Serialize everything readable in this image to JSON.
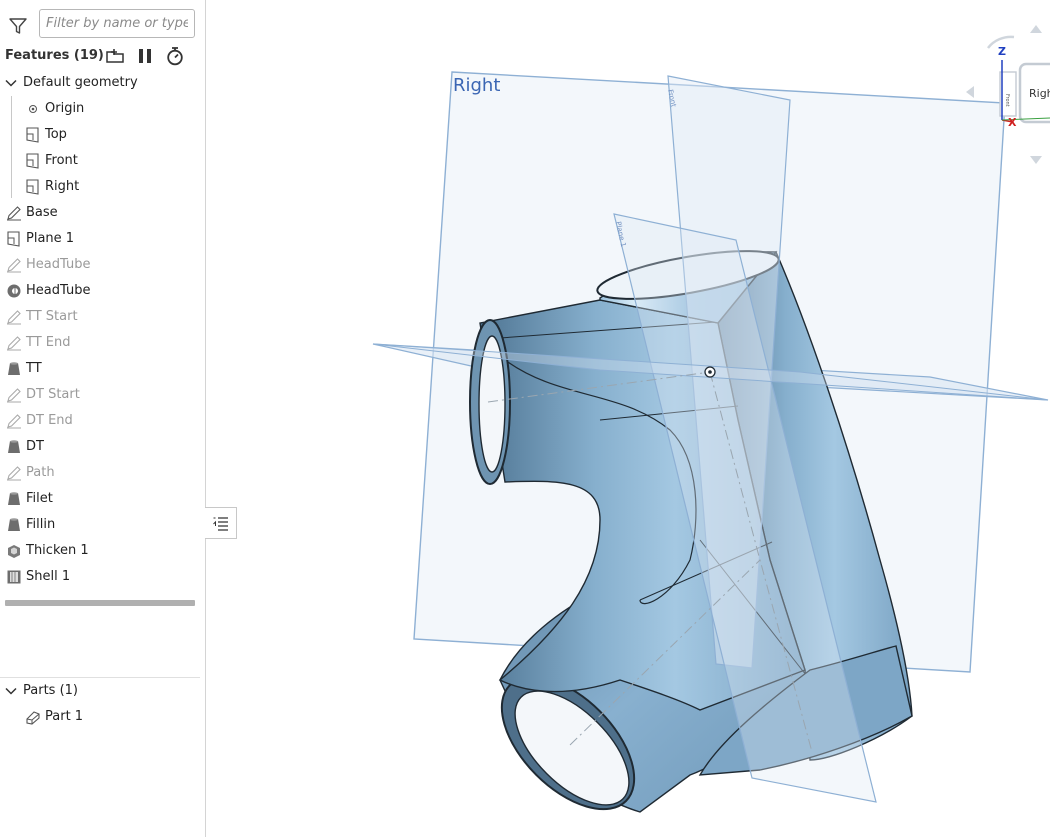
{
  "filter": {
    "placeholder": "Filter by name or type"
  },
  "features": {
    "title": "Features (19)",
    "items": [
      {
        "label": "Default geometry",
        "icon": "chevron-down-icon",
        "suppressed": false
      },
      {
        "label": "Origin",
        "icon": "origin-icon",
        "suppressed": false
      },
      {
        "label": "Top",
        "icon": "plane-icon",
        "suppressed": false
      },
      {
        "label": "Front",
        "icon": "plane-icon",
        "suppressed": false
      },
      {
        "label": "Right",
        "icon": "plane-icon",
        "suppressed": false
      },
      {
        "label": "Base",
        "icon": "sketch-icon",
        "suppressed": false
      },
      {
        "label": "Plane 1",
        "icon": "plane-icon",
        "suppressed": false
      },
      {
        "label": "HeadTube",
        "icon": "sketch-icon",
        "suppressed": true
      },
      {
        "label": "HeadTube",
        "icon": "revolve-icon",
        "suppressed": false
      },
      {
        "label": "TT Start",
        "icon": "sketch-icon",
        "suppressed": true
      },
      {
        "label": "TT End",
        "icon": "sketch-icon",
        "suppressed": true
      },
      {
        "label": "TT",
        "icon": "loft-icon",
        "suppressed": false
      },
      {
        "label": "DT Start",
        "icon": "sketch-icon",
        "suppressed": true
      },
      {
        "label": "DT End",
        "icon": "sketch-icon",
        "suppressed": true
      },
      {
        "label": "DT",
        "icon": "loft-icon",
        "suppressed": false
      },
      {
        "label": "Path",
        "icon": "sketch-icon",
        "suppressed": true
      },
      {
        "label": "Filet",
        "icon": "loft-icon",
        "suppressed": false
      },
      {
        "label": "Fillin",
        "icon": "loft-icon",
        "suppressed": false
      },
      {
        "label": "Thicken 1",
        "icon": "thicken-icon",
        "suppressed": false
      },
      {
        "label": "Shell 1",
        "icon": "shell-icon",
        "suppressed": false
      }
    ]
  },
  "parts": {
    "title": "Parts (1)",
    "items": [
      {
        "label": "Part 1",
        "icon": "part-icon"
      }
    ]
  },
  "viewport": {
    "plane_labels": {
      "right": "Right",
      "front": "Front",
      "plane1": "Plane 1"
    }
  },
  "viewcube": {
    "axis_z": "Z",
    "axis_x": "X",
    "face_label": "Right",
    "face_label_small": "Front"
  },
  "colors": {
    "part": "#8fb7d4",
    "plane": "#dbe6f3",
    "plane_edge": "#7ea3cc",
    "plane_label": "#3b66b3",
    "suppressed": "#9a9a9a"
  }
}
